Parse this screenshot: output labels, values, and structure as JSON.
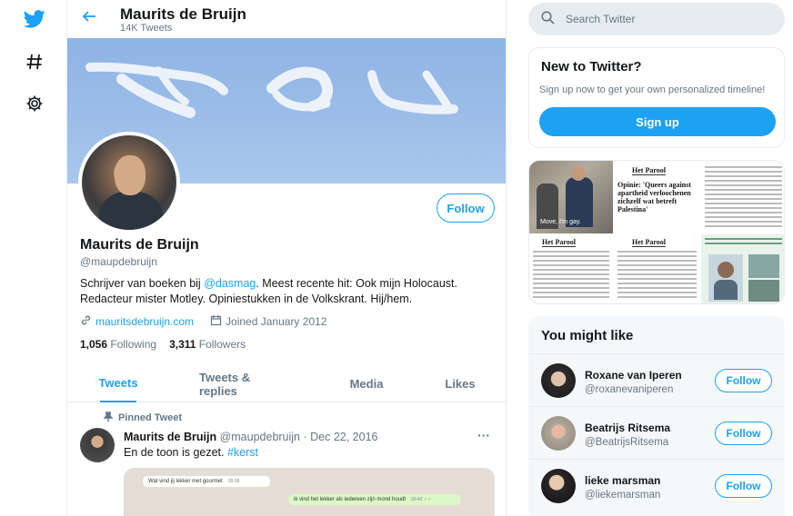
{
  "colors": {
    "accent": "#1da1f2",
    "text": "#14171a",
    "secondary": "#657786",
    "border": "#e6ecf0"
  },
  "nav": {
    "icons": [
      "twitter-logo-icon",
      "hashtag-explore-icon",
      "settings-gear-icon"
    ]
  },
  "header": {
    "name": "Maurits de Bruijn",
    "tweet_count": "14K Tweets"
  },
  "profile": {
    "name": "Maurits de Bruijn",
    "handle": "@maupdebruijn",
    "follow_label": "Follow",
    "bio_prefix": "Schrijver van boeken bij ",
    "bio_link": "@dasmag",
    "bio_suffix": ". Meest recente hit: Ook mijn Holocaust. Redacteur mister Motley. Opiniestukken in de Volkskrant. Hij/hem.",
    "website": "mauritsdebruijn.com",
    "joined": "Joined January 2012",
    "following_count": "1,056",
    "following_label": "Following",
    "followers_count": "3,311",
    "followers_label": "Followers"
  },
  "tabs": [
    {
      "label": "Tweets",
      "active": true
    },
    {
      "label": "Tweets & replies",
      "active": false
    },
    {
      "label": "Media",
      "active": false
    },
    {
      "label": "Likes",
      "active": false
    }
  ],
  "pinned_tweet": {
    "pinned_label": "Pinned Tweet",
    "author": "Maurits de Bruijn",
    "meta": "@maupdebruijn · Dec 22, 2016",
    "text": "En de toon is gezet. ",
    "hashtag": "#kerst",
    "chat_message_1": "Wat vind jij lekker met gourmet",
    "chat_time_1": "09:38",
    "chat_message_2": "ik vind het lekker als iedereen zijn mond houdt",
    "chat_time_2": "09:42 ✓✓"
  },
  "sidebar": {
    "search_placeholder": "Search Twitter",
    "new_title": "New to Twitter?",
    "new_subtitle": "Sign up now to get your own personalized timeline!",
    "signup_label": "Sign up",
    "media": {
      "video_caption": "Move, I'm gay.",
      "parool": "Het Parool",
      "opinion_headline": "Opinie: 'Queers against apartheid verloochenen zichzelf wat betreft Palestina'"
    },
    "might_like_title": "You might like",
    "suggestions": [
      {
        "name": "Roxane van Iperen",
        "handle": "@roxanevaniperen",
        "follow": "Follow"
      },
      {
        "name": "Beatrijs Ritsema",
        "handle": "@BeatrijsRitsema",
        "follow": "Follow"
      },
      {
        "name": "lieke marsman",
        "handle": "@liekemarsman",
        "follow": "Follow"
      }
    ]
  }
}
